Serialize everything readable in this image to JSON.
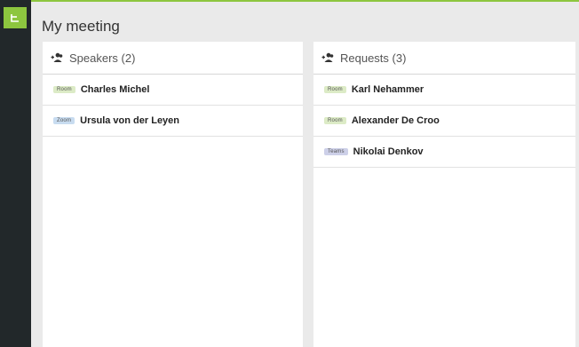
{
  "colors": {
    "accent": "#8dc63f",
    "sidebar": "#22282a",
    "badge_room": "#dcebc6",
    "badge_zoom": "#c8dcf0",
    "badge_teams": "#cdd0e8"
  },
  "app": {
    "title": "My meeting",
    "logo_icon": "app-logo-icon"
  },
  "speakers": {
    "header": "Speakers (2)",
    "icon": "add-user-icon",
    "items": [
      {
        "badge": "Room",
        "name": "Charles Michel"
      },
      {
        "badge": "Zoom",
        "name": "Ursula von der Leyen"
      }
    ]
  },
  "requests": {
    "header": "Requests (3)",
    "icon": "add-user-icon",
    "items": [
      {
        "badge": "Room",
        "name": "Karl Nehammer"
      },
      {
        "badge": "Room",
        "name": "Alexander De Croo"
      },
      {
        "badge": "Teams",
        "name": "Nikolai Denkov"
      }
    ]
  }
}
